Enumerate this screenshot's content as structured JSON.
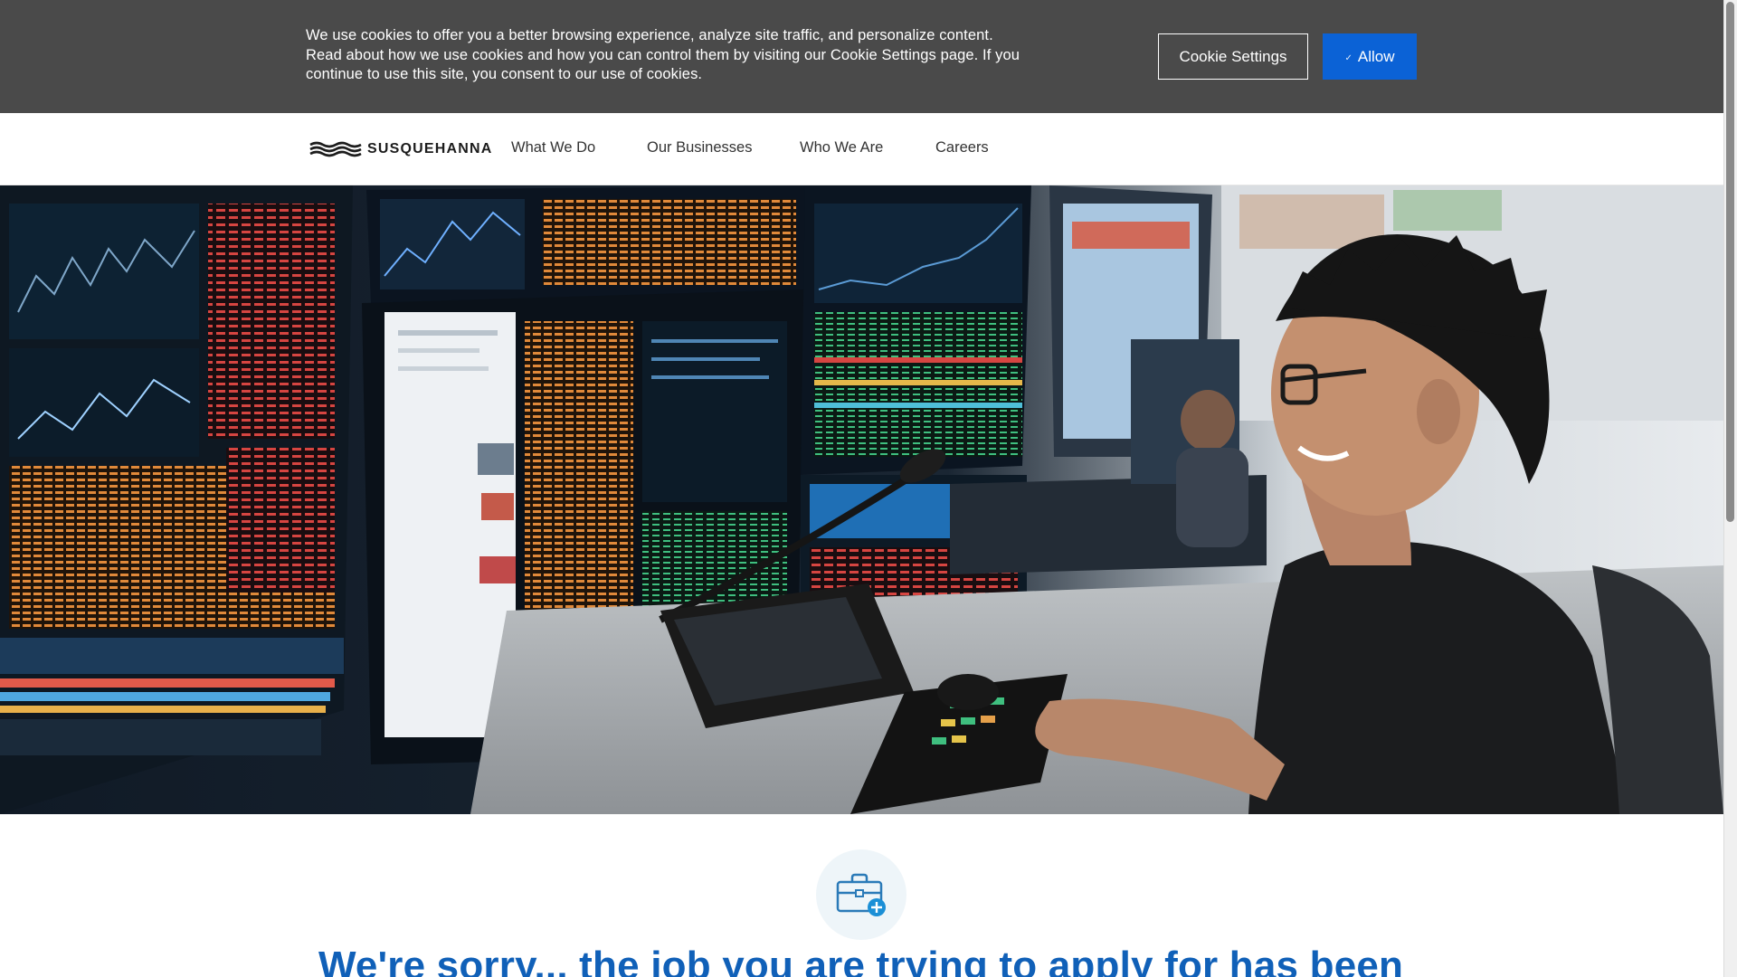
{
  "cookie_banner": {
    "text": "We use cookies to offer you a better browsing experience, analyze site traffic, and personalize content. Read about how we use cookies and how you can control them by visiting our Cookie Settings page. If you continue to use this site, you consent to our use of cookies.",
    "settings_label": "Cookie Settings",
    "allow_label": "Allow",
    "allow_icon": "check-icon"
  },
  "nav": {
    "logo_text": "SUSQUEHANNA",
    "items": [
      {
        "label": "What We Do"
      },
      {
        "label": "Our Businesses"
      },
      {
        "label": "Who We Are"
      },
      {
        "label": "Careers"
      }
    ]
  },
  "hero": {
    "image": "trader-at-trading-desk-photo"
  },
  "main": {
    "icon": "briefcase-plus-icon",
    "heading": "We're sorry... the job you are trying to apply for has been"
  },
  "colors": {
    "banner_bg": "#4a4a4a",
    "allow_button": "#0b62d6",
    "heading_blue": "#1060b8",
    "icon_circle": "#eef5f9"
  }
}
